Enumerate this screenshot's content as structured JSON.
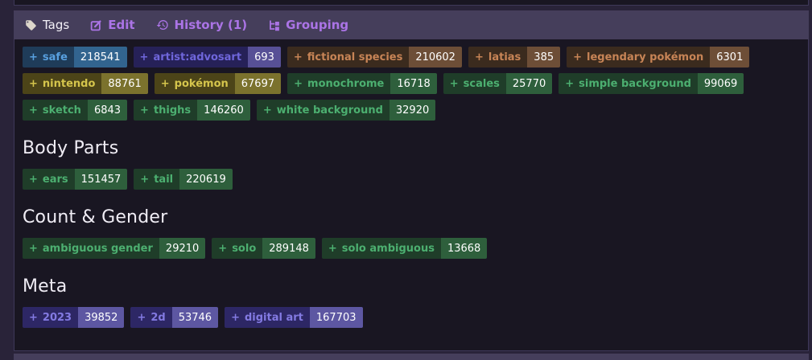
{
  "theme": {
    "page_bg": "#292339",
    "panel_bg": "#191622",
    "panel_border": "#3e3859",
    "bar_bg": "#453e5b",
    "tab_fg": "#ab74e6",
    "tab_active_fg": "#f3f1f7",
    "header_fg": "#f0edf5",
    "tag_icon_color": "#ddd7cb"
  },
  "plus_label": "+",
  "tab_bar": {
    "tabs": [
      {
        "label": "Tags",
        "icon": "tag-icon",
        "active": true
      },
      {
        "label": "Edit",
        "icon": "edit-icon",
        "active": false
      },
      {
        "label": "History (1)",
        "icon": "history-icon",
        "active": false
      },
      {
        "label": "Grouping",
        "icon": "grouping-icon",
        "active": false
      }
    ]
  },
  "categories": {
    "rating": {
      "name_bg": "#1f3c59",
      "name_fg": "#58a0df",
      "count_bg": "#32648f",
      "count_fg": "#ffffff"
    },
    "artist": {
      "name_bg": "#262158",
      "name_fg": "#6f66db",
      "count_bg": "#575096",
      "count_fg": "#ffffff"
    },
    "species": {
      "name_bg": "#3b2b1e",
      "name_fg": "#c78456",
      "count_bg": "#6d4e37",
      "count_fg": "#ffffff"
    },
    "copyright": {
      "name_bg": "#4c4418",
      "name_fg": "#d5c54c",
      "count_bg": "#7b722d",
      "count_fg": "#ffffff"
    },
    "general": {
      "name_bg": "#1f3d29",
      "name_fg": "#4caf70",
      "count_bg": "#2e5f3c",
      "count_fg": "#ffffff"
    },
    "meta": {
      "name_bg": "#2d2765",
      "name_fg": "#837ae2",
      "count_bg": "#5d57a2",
      "count_fg": "#ffffff"
    }
  },
  "sections": [
    {
      "title": "",
      "tags": [
        {
          "name": "safe",
          "count": "218541",
          "category": "rating"
        },
        {
          "name": "artist:advosart",
          "count": "693",
          "category": "artist"
        },
        {
          "name": "fictional species",
          "count": "210602",
          "category": "species"
        },
        {
          "name": "latias",
          "count": "385",
          "category": "species"
        },
        {
          "name": "legendary pokémon",
          "count": "6301",
          "category": "species"
        },
        {
          "name": "nintendo",
          "count": "88761",
          "category": "copyright"
        },
        {
          "name": "pokémon",
          "count": "67697",
          "category": "copyright"
        },
        {
          "name": "monochrome",
          "count": "16718",
          "category": "general"
        },
        {
          "name": "scales",
          "count": "25770",
          "category": "general"
        },
        {
          "name": "simple background",
          "count": "99069",
          "category": "general"
        },
        {
          "name": "sketch",
          "count": "6843",
          "category": "general"
        },
        {
          "name": "thighs",
          "count": "146260",
          "category": "general"
        },
        {
          "name": "white background",
          "count": "32920",
          "category": "general"
        }
      ]
    },
    {
      "title": "Body Parts",
      "tags": [
        {
          "name": "ears",
          "count": "151457",
          "category": "general"
        },
        {
          "name": "tail",
          "count": "220619",
          "category": "general"
        }
      ]
    },
    {
      "title": "Count & Gender",
      "tags": [
        {
          "name": "ambiguous gender",
          "count": "29210",
          "category": "general"
        },
        {
          "name": "solo",
          "count": "289148",
          "category": "general"
        },
        {
          "name": "solo ambiguous",
          "count": "13668",
          "category": "general"
        }
      ]
    },
    {
      "title": "Meta",
      "tags": [
        {
          "name": "2023",
          "count": "39852",
          "category": "meta"
        },
        {
          "name": "2d",
          "count": "53746",
          "category": "meta"
        },
        {
          "name": "digital art",
          "count": "167703",
          "category": "meta"
        }
      ]
    }
  ]
}
